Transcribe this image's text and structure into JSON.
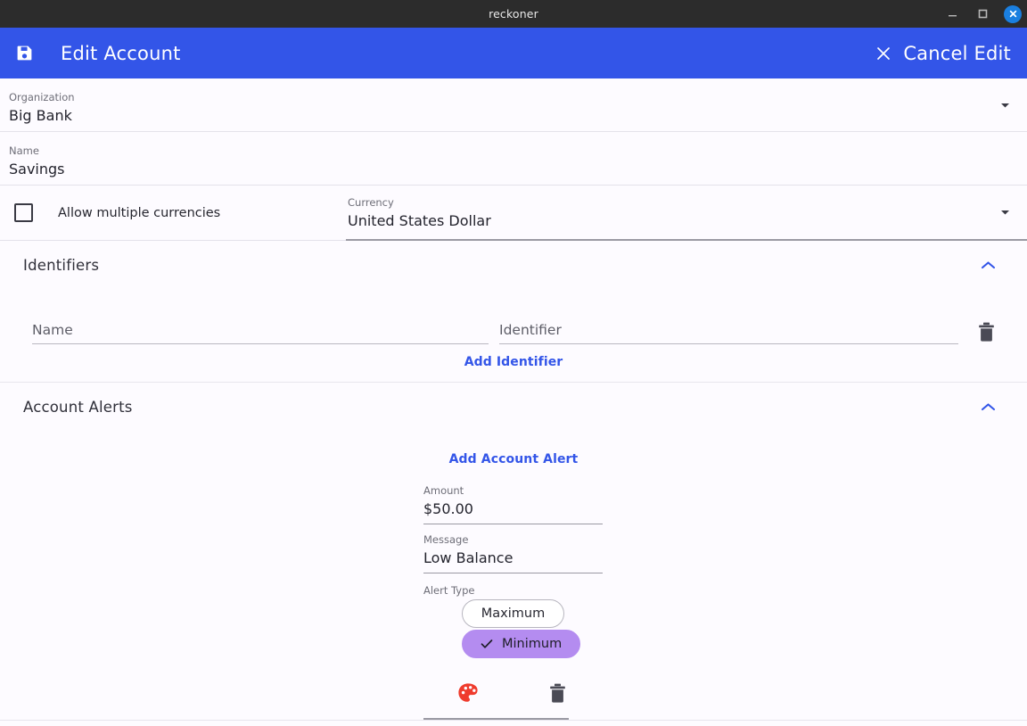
{
  "window": {
    "title": "reckoner",
    "controls": {
      "minimize": "minimize",
      "maximize": "maximize",
      "close": "close"
    }
  },
  "appbar": {
    "save_icon": "save-icon",
    "title": "Edit Account",
    "cancel_label": "Cancel Edit",
    "cancel_icon": "close-x-icon",
    "background_color": "#3355e8"
  },
  "form": {
    "organization": {
      "label": "Organization",
      "value": "Big Bank",
      "dropdown_icon": "triangle-down-icon"
    },
    "name": {
      "label": "Name",
      "value": "Savings"
    },
    "allow_multiple_currencies": {
      "label": "Allow multiple currencies",
      "checked": false
    },
    "currency": {
      "label": "Currency",
      "value": "United States Dollar",
      "dropdown_icon": "triangle-down-icon"
    }
  },
  "identifiers": {
    "section_title": "Identifiers",
    "collapse_icon": "chevron-up-icon",
    "expanded": true,
    "rows": [
      {
        "name_placeholder": "Name",
        "name_value": "",
        "identifier_placeholder": "Identifier",
        "identifier_value": "",
        "delete_icon": "trash-icon"
      }
    ],
    "add_link": "Add Identifier"
  },
  "account_alerts": {
    "section_title": "Account Alerts",
    "collapse_icon": "chevron-up-icon",
    "expanded": true,
    "add_link": "Add Account Alert",
    "alerts": [
      {
        "amount": {
          "label": "Amount",
          "value": "$50.00"
        },
        "message": {
          "label": "Message",
          "value": "Low Balance"
        },
        "alert_type": {
          "label": "Alert Type",
          "options": [
            {
              "label": "Maximum",
              "selected": false
            },
            {
              "label": "Minimum",
              "selected": true
            }
          ]
        },
        "actions": {
          "color_icon": "palette-icon",
          "delete_icon": "trash-icon"
        }
      }
    ]
  },
  "colors": {
    "accent_blue": "#3355e8",
    "selected_chip": "#b48cf0",
    "palette_red": "#ef3b2d",
    "titlebar": "#2c2c2c",
    "page_background": "#fdfbff"
  }
}
